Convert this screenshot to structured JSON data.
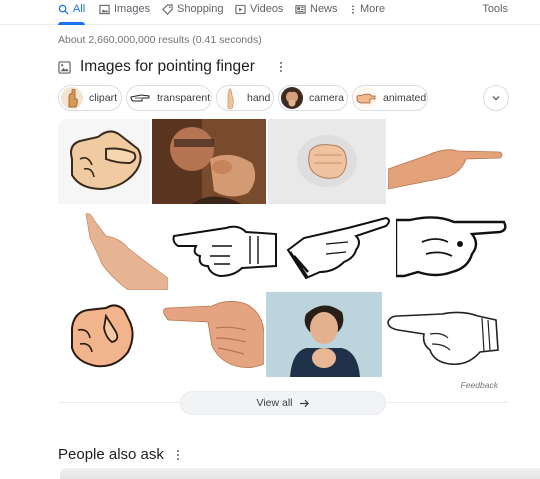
{
  "tabs": [
    {
      "label": "All",
      "icon": "search-icon",
      "active": true
    },
    {
      "label": "Images",
      "icon": "image-icon"
    },
    {
      "label": "Shopping",
      "icon": "tag-icon"
    },
    {
      "label": "Videos",
      "icon": "play-icon"
    },
    {
      "label": "News",
      "icon": "news-icon"
    },
    {
      "label": "More",
      "icon": "more-vert-icon"
    }
  ],
  "tools_label": "Tools",
  "stats": "About 2,660,000,000 results (0.41 seconds)",
  "images_section": {
    "title": "Images for pointing finger",
    "chips": [
      {
        "label": "clipart"
      },
      {
        "label": "transparent"
      },
      {
        "label": "hand"
      },
      {
        "label": "camera"
      },
      {
        "label": "animated"
      }
    ],
    "feedback": "Feedback",
    "view_all": "View all"
  },
  "paa_title": "People also ask",
  "colors": {
    "accent": "#1a73e8",
    "chip_border": "#dadce0",
    "muted_text": "#70757a",
    "skin": "#f2c8a0"
  }
}
